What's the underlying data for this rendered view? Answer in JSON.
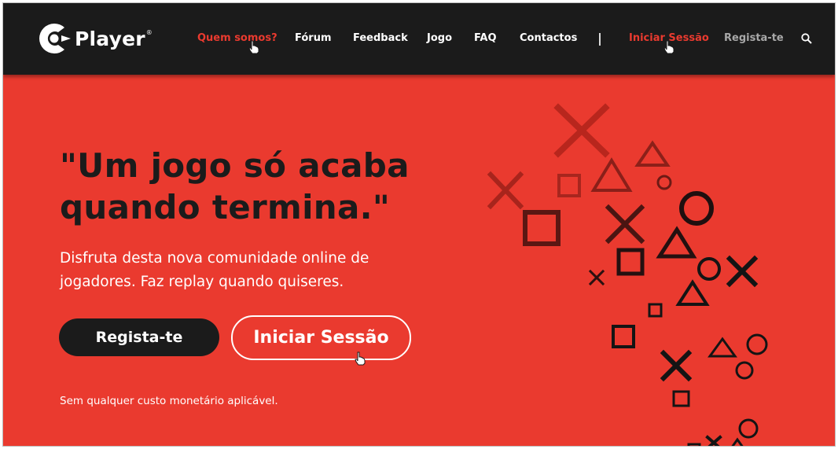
{
  "brand": {
    "name": "Player",
    "registered_mark": "®"
  },
  "nav": {
    "about": "Quem somos?",
    "forum": "Fórum",
    "feedback": "Feedback",
    "game": "Jogo",
    "faq": "FAQ",
    "contacts": "Contactos",
    "login": "Iniciar Sessão",
    "register": "Regista-te",
    "search_icon": "search-icon"
  },
  "hero": {
    "title_line1": "\"Um jogo só acaba",
    "title_line2": "quando termina.\"",
    "subtitle_line1": "Disfruta desta nova comunidade online de",
    "subtitle_line2": "jogadores. Faz replay quando quiseres.",
    "register_button": "Regista-te",
    "login_button": "Iniciar Sessão",
    "fineprint": "Sem qualquer custo monetário aplicável."
  },
  "colors": {
    "accent": "#ea3a2f",
    "dark": "#1b1b1b",
    "muted_nav": "#a8a8a8",
    "text_light": "#ffffff"
  },
  "decor_icons": [
    "cross-icon",
    "square-icon",
    "triangle-icon",
    "circle-icon"
  ]
}
